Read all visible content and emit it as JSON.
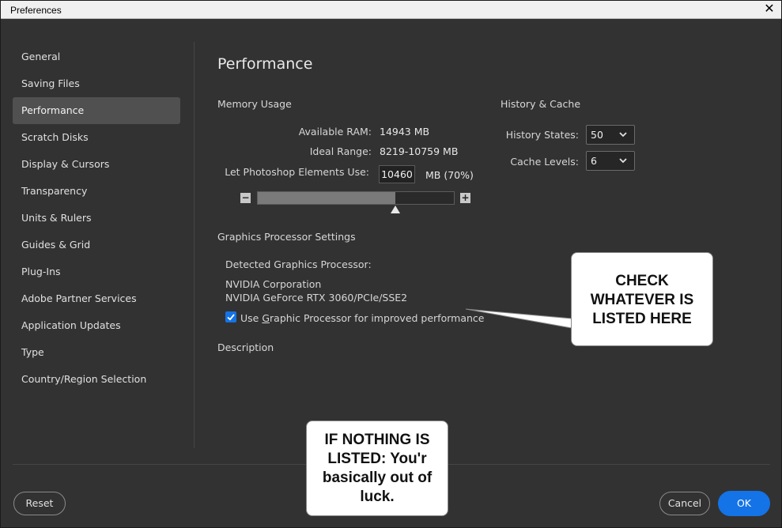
{
  "window": {
    "title": "Preferences"
  },
  "sidebar": {
    "items": [
      {
        "label": "General",
        "active": false
      },
      {
        "label": "Saving Files",
        "active": false
      },
      {
        "label": "Performance",
        "active": true
      },
      {
        "label": "Scratch Disks",
        "active": false
      },
      {
        "label": "Display & Cursors",
        "active": false
      },
      {
        "label": "Transparency",
        "active": false
      },
      {
        "label": "Units & Rulers",
        "active": false
      },
      {
        "label": "Guides & Grid",
        "active": false
      },
      {
        "label": "Plug-Ins",
        "active": false
      },
      {
        "label": "Adobe Partner Services",
        "active": false
      },
      {
        "label": "Application Updates",
        "active": false
      },
      {
        "label": "Type",
        "active": false
      },
      {
        "label": "Country/Region Selection",
        "active": false
      }
    ]
  },
  "main": {
    "title": "Performance",
    "memory": {
      "heading": "Memory Usage",
      "available_label": "Available RAM:",
      "available_value": "14943 MB",
      "ideal_label": "Ideal Range:",
      "ideal_value": "8219-10759 MB",
      "use_label": "Let Photoshop Elements Use:",
      "use_value": "10460",
      "use_suffix": "MB (70%)",
      "slider_fraction": 0.7
    },
    "history": {
      "heading": "History & Cache",
      "states_label": "History States:",
      "states_value": "50",
      "cache_label": "Cache Levels:",
      "cache_value": "6"
    },
    "gpu": {
      "heading": "Graphics Processor Settings",
      "detected_label": "Detected Graphics Processor:",
      "vendor": "NVIDIA Corporation",
      "model": "NVIDIA GeForce RTX 3060/PCIe/SSE2",
      "use_checkbox_label_pre": "Use ",
      "use_checkbox_label_accel": "G",
      "use_checkbox_label_post": "raphic Processor for improved performance",
      "use_checked": true
    },
    "description": {
      "heading": "Description"
    }
  },
  "annotations": {
    "callout1_lines": [
      "CHECK",
      "WHATEVER IS",
      "LISTED HERE"
    ],
    "callout2_lines": [
      "IF NOTHING IS",
      "LISTED:  You'r",
      "basically out of",
      "luck."
    ]
  },
  "footer": {
    "reset_label": "Reset",
    "cancel_label": "Cancel",
    "ok_label": "OK"
  },
  "colors": {
    "accent": "#1473e6",
    "panel": "#323232",
    "selected": "#505050"
  },
  "icons": {
    "close": "close-icon",
    "minus": "minus-icon",
    "plus": "plus-icon",
    "chevron": "chevron-down-icon",
    "check": "checkmark-icon"
  }
}
